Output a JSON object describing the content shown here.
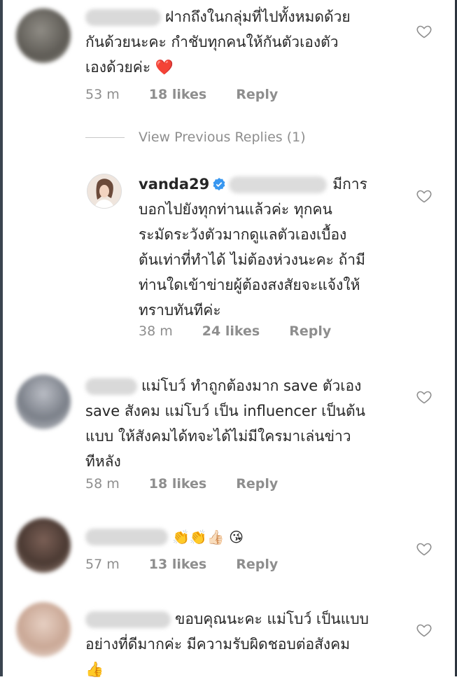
{
  "comments": [
    {
      "text_lines": [
        "ฝากถึงในกลุ่มที่ไปทั้งหมดด้วย",
        "กันด้วยนะคะ กำชับทุกคนให้กันตัวเองตัว",
        "เองด้วยค่ะ ❤️"
      ],
      "time": "53 m",
      "likes": "18 likes",
      "reply": "Reply"
    },
    {
      "text_lines": [
        "แม่โบว์ ทำถูกต้องมาก save ตัวเอง",
        "save สังคม แม่โบว์ เป็น influencer เป็นต้น",
        "แบบ ให้สังคมได้ทจะได้ไม่มีใครมาเล่นข่าว",
        "ทีหลัง"
      ],
      "time": "58 m",
      "likes": "18 likes",
      "reply": "Reply"
    },
    {
      "text_lines": [
        "👏👏👍🏻 😘"
      ],
      "time": "57 m",
      "likes": "13 likes",
      "reply": "Reply"
    },
    {
      "text_lines": [
        "ขอบคุณนะคะ แม่โบว์ เป็นแบบ",
        "อย่างที่ดีมากค่ะ มีความรับผิดชอบต่อสังคม",
        "👍"
      ]
    }
  ],
  "view_previous": "View Previous Replies (1)",
  "reply": {
    "username": "vanda29",
    "text_lines": [
      "มีการ",
      "บอกไปยังทุกท่านแล้วค่ะ ทุกคน",
      "ระมัดระวังตัวมากดูแลตัวเองเบื้อง",
      "ต้นเท่าที่ทำได้ ไม่ต้องห่วงนะคะ ถ้ามี",
      "ท่านใดเข้าข่ายผู้ต้องสงสัยจะแจ้งให้",
      "ทราบทันทีค่ะ"
    ],
    "time": "38 m",
    "likes": "24 likes",
    "reply": "Reply"
  },
  "icons": {
    "like": "heart-outline-icon",
    "verified": "verified-badge-icon"
  },
  "colors": {
    "text": "#262626",
    "meta": "#8e8e8e",
    "verified": "#3897f0"
  }
}
